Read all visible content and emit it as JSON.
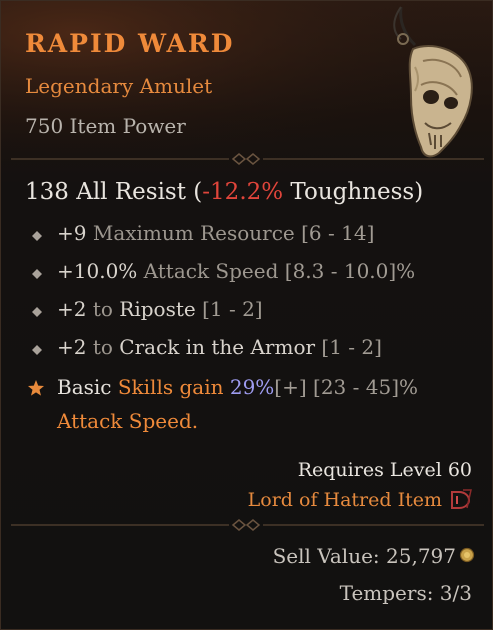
{
  "item": {
    "name": "RAPID WARD",
    "type": "Legendary Amulet",
    "item_power": "750 Item Power"
  },
  "primary_stat": {
    "value": "138 All Resist",
    "open": " (",
    "toughness": "-12.2%",
    "toughness_label": " Toughness)"
  },
  "affixes": [
    {
      "value": "+9",
      "label": " Maximum Resource ",
      "range": "[6 - 14]"
    },
    {
      "value": "+10.0%",
      "label": " Attack Speed ",
      "range": "[8.3 - 10.0]%"
    },
    {
      "value": "+2",
      "to": " to ",
      "skill": "Riposte",
      "range": " [1 - 2]"
    },
    {
      "value": "+2",
      "to": " to ",
      "skill": "Crack in the Armor",
      "range": " [1 - 2]"
    }
  ],
  "legendary_aspect": {
    "prefix": "Basic ",
    "skills_gain": "Skills gain",
    "percent": " 29%",
    "bracket": "[+]",
    "range": " [23 - 45]%",
    "line2": "Attack Speed."
  },
  "requirements": {
    "level": "Requires Level 60",
    "expansion": "Lord of Hatred Item"
  },
  "footer": {
    "sell_value": "Sell Value: 25,797",
    "tempers": "Tempers: 3/3"
  },
  "icons": {
    "aspect_star": "star-icon",
    "affix_bullet": "diamond-bullet-icon",
    "gold": "gold-coin-icon",
    "expansion": "lord-of-hatred-icon",
    "amulet": "skull-amulet-icon"
  },
  "colors": {
    "legendary_orange": "#ef8a3a",
    "negative_red": "#e0453b",
    "roll_blue": "#9e9cf0",
    "text": "#e9e5df"
  }
}
